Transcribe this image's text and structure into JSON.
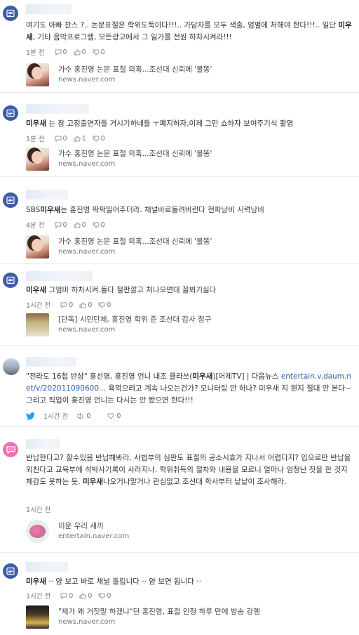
{
  "posts": [
    {
      "type": "blog",
      "text_html": "여기도 아빠 찬스 ?.. 논문표절은 학위도둑이다!!!.. 가담자를 모두 색출, 엄별에 처해야 한다!!!.. 일단 <b>미우새</b>, 기타 음악프로그램, 모든광고에서 그 일가를 전원 하차시켜라!!!",
      "time": "1분 전",
      "comments": "0",
      "likes": "0",
      "dislikes": "0",
      "card_title": "가수 홍진영 논문 표절 의혹...조선대 신뢰에 '불똥'",
      "card_domain": "news.naver.com"
    },
    {
      "type": "blog",
      "text_html": "<b>미우새</b> 는 참 고정출연자들 거시기하네들 ㅜ폐지하자,이제 그만 쇼하자 보여주기식 촬영",
      "time": "1분 전",
      "comments": "0",
      "likes": "1",
      "dislikes": "0",
      "card_title": "가수 홍진영 논문 표절 의혹...조선대 신뢰에 '불똥'",
      "card_domain": "news.naver.com"
    },
    {
      "type": "blog",
      "text_html": "SBS<b>미우새</b>는 홍진영 팍팍밀어주더라. 채널바로돌려버린다 전파낭비 시력낭비",
      "time": "4분 전",
      "comments": "0",
      "likes": "0",
      "dislikes": "0",
      "card_title": "가수 홍진영 논문 표절 의혹...조선대 신뢰에 '불똥'",
      "card_domain": "news.naver.com"
    },
    {
      "type": "blog",
      "text_html": "<b>미우새</b> 그엄마 하차시켜.들다 철판깔고 처나오면대 꼴뵈기싫다",
      "time": "1시간 전",
      "comments": "0",
      "likes": "0",
      "dislikes": "0",
      "card_title": "[단독] 시민단체, 홍진영 학위 준 조선대 감사 청구",
      "card_domain": "news.naver.com"
    },
    {
      "type": "twitter",
      "text_html": "\"전라도 16첩 반상\" 홍선영, 홍진영 언니 내조 클라쓰(<b>미우새</b>)[어제TV] | 다음뉴스 <span class='link-text'>entertain.v.daum.net/v/202011090600...</span> 욕먹으려고 계속 나오는건가? 모니터링 안 하나? 미우새 지 뭔지 절대 안 본다~ 그리고 직업이 홍진영 언니는 다시는 안 봤으면 한다!!!",
      "time": "1시간 전",
      "retweets": "0",
      "likes": "0"
    },
    {
      "type": "bubble",
      "text_html": "반납한다고? 할수있음 반납해봐라. 사법부의 심판도 표절의 공소시효가 지나서 어렵다지? 입으로만 반납을 외친다고 교육부에 석박사기록이 사라지나. 학위취득의 절차와 내용을 모르니 얼마나 엄청난 짓을 한 것지 체감도 못하는 듯. <b>미우새</b>나오거나말거나 관심없고 조선대 학사부터 낱낱이 조사해라.",
      "time": "1시간 전",
      "card_title": "미운 우리 새끼",
      "card_domain": "entertain.naver.com"
    },
    {
      "type": "blog",
      "text_html": "<b>미우새</b> ·· 얌 보고 바로 채널 돌립니다 ·· 얌 보면 됩니다 ··",
      "time": "1시간 전",
      "comments": "0",
      "likes": "0",
      "dislikes": "0",
      "card_title": "\"제가 왜 거짓말 하겠냐\"던 홍진영, 표절 인정 하루 만에 방송 강행",
      "card_domain": "news.naver.com"
    }
  ],
  "colors": {
    "blog_avatar": "#3d5ca8",
    "bubble_avatar": "#ef6fb4",
    "twitter_blue": "#1da1f2",
    "link": "#2a5db0"
  }
}
